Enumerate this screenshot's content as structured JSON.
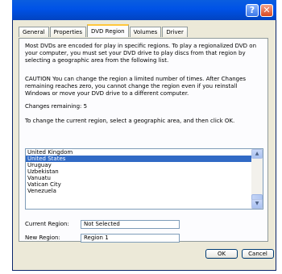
{
  "titlebar": {
    "help_label": "?",
    "close_label": "✕"
  },
  "tabs": [
    {
      "label": "General"
    },
    {
      "label": "Properties"
    },
    {
      "label": "DVD Region"
    },
    {
      "label": "Volumes"
    },
    {
      "label": "Driver"
    }
  ],
  "active_tab": "DVD Region",
  "content": {
    "intro": "Most DVDs are encoded for play in specific regions. To play a regionalized DVD on your computer, you must set your DVD drive to play discs from that region by selecting a geographic area from the following list.",
    "caution": "CAUTION  You can change the region a limited number of times. After Changes remaining reaches zero, you cannot change the region even if you reinstall Windows or move your DVD drive to a different computer.",
    "changes_remaining": "Changes remaining: 5",
    "instruction": "To change the current region, select a geographic area, and then click OK."
  },
  "region_list": {
    "items": [
      "United Kingdom",
      "United States",
      "Uruguay",
      "Uzbekistan",
      "Vanuatu",
      "Vatican City",
      "Venezuela"
    ],
    "selected": "United States"
  },
  "current_region": {
    "label": "Current Region:",
    "value": "Not Selected"
  },
  "new_region": {
    "label": "New Region:",
    "value": "Region 1"
  },
  "buttons": {
    "ok": "OK",
    "cancel": "Cancel"
  },
  "colors": {
    "titlebar": "#0052e6",
    "selection": "#316ac5",
    "active_tab_accent": "#ffc73c"
  }
}
